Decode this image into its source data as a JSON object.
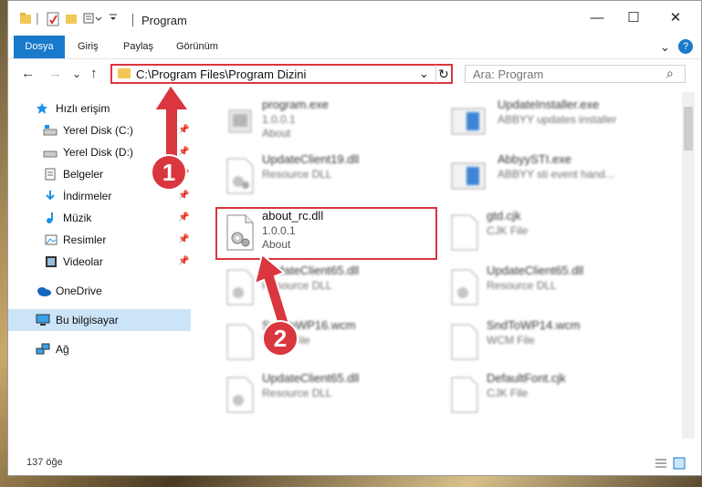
{
  "window": {
    "title": "Program",
    "controls": {
      "minimize": "—",
      "maximize": "☐",
      "close": "✕"
    }
  },
  "ribbon": {
    "tabs": [
      "Dosya",
      "Giriş",
      "Paylaş",
      "Görünüm"
    ],
    "expand": "⌄",
    "help": "?"
  },
  "navigation": {
    "back": "←",
    "forward": "→",
    "recent": "⌄",
    "up": "↑",
    "address": "C:\\Program Files\\Program Dizini",
    "dropdown": "⌄",
    "refresh": "↻",
    "search_placeholder": "Ara: Program",
    "search_icon": "⌕"
  },
  "sidebar": {
    "items": [
      {
        "label": "Hızlı erişim",
        "icon": "star-icon",
        "pinned": false
      },
      {
        "label": "Yerel Disk (C:)",
        "icon": "drive-icon",
        "pinned": true
      },
      {
        "label": "Yerel Disk (D:)",
        "icon": "drive-icon",
        "pinned": true
      },
      {
        "label": "Belgeler",
        "icon": "document-icon",
        "pinned": true
      },
      {
        "label": "İndirmeler",
        "icon": "download-icon",
        "pinned": true
      },
      {
        "label": "Müzik",
        "icon": "music-icon",
        "pinned": true
      },
      {
        "label": "Resimler",
        "icon": "picture-icon",
        "pinned": true
      },
      {
        "label": "Videolar",
        "icon": "video-icon",
        "pinned": true
      },
      {
        "label": "OneDrive",
        "icon": "cloud-icon",
        "pinned": false
      },
      {
        "label": "Bu bilgisayar",
        "icon": "computer-icon",
        "pinned": false
      },
      {
        "label": "Ağ",
        "icon": "network-icon",
        "pinned": false
      }
    ],
    "pin_glyph": "📌"
  },
  "files": [
    {
      "name": "program.exe",
      "line2": "1.0.0.1",
      "line3": "About",
      "icon": "exe-icon"
    },
    {
      "name": "UpdateInstaller.exe",
      "line2": "ABBYY updates installer",
      "line3": "",
      "icon": "app-icon"
    },
    {
      "name": "UpdateClient19.dll",
      "line2": "Resource DLL",
      "line3": "",
      "icon": "dll-icon"
    },
    {
      "name": "AbbyySTI.exe",
      "line2": "ABBYY sti event hand...",
      "line3": "",
      "icon": "app-icon"
    },
    {
      "name": "about_rc.dll",
      "line2": "1.0.0.1",
      "line3": "About",
      "icon": "dll-icon"
    },
    {
      "name": "gtd.cjk",
      "line2": "CJK File",
      "line3": "",
      "icon": "file-icon"
    },
    {
      "name": "UpdateClient65.dll",
      "line2": "Resource DLL",
      "line3": "",
      "icon": "dll-icon"
    },
    {
      "name": "UpdateClient65.dll",
      "line2": "Resource DLL",
      "line3": "",
      "icon": "dll-icon"
    },
    {
      "name": "SndToWP16.wcm",
      "line2": "WCM File",
      "line3": "",
      "icon": "file-icon"
    },
    {
      "name": "SndToWP14.wcm",
      "line2": "WCM File",
      "line3": "",
      "icon": "file-icon"
    },
    {
      "name": "UpdateClient65.dll",
      "line2": "Resource DLL",
      "line3": "",
      "icon": "dll-icon"
    },
    {
      "name": "DefaultFont.cjk",
      "line2": "CJK File",
      "line3": "",
      "icon": "file-icon"
    }
  ],
  "annotations": {
    "step1": "1",
    "step2": "2"
  },
  "status": {
    "count": "137 öğe"
  },
  "colors": {
    "accent": "#1979ca",
    "highlight": "#d9363e",
    "selected_bg": "#cce4f7",
    "folder": "#f3c755"
  }
}
